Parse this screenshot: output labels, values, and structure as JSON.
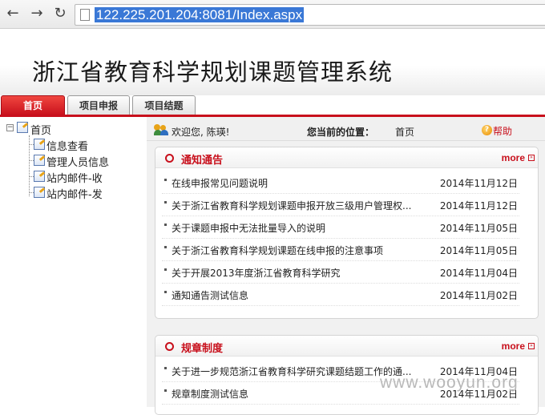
{
  "browser": {
    "url": "122.225.201.204:8081/Index.aspx"
  },
  "header": {
    "system_title": "浙江省教育科学规划课题管理系统"
  },
  "tabs": [
    {
      "label": "首页",
      "active": true
    },
    {
      "label": "项目申报",
      "active": false
    },
    {
      "label": "项目结题",
      "active": false
    }
  ],
  "sidebar": {
    "root": {
      "label": "首页",
      "toggle": "−"
    },
    "items": [
      {
        "label": "信息查看"
      },
      {
        "label": "管理人员信息"
      },
      {
        "label": "站内邮件-收"
      },
      {
        "label": "站内邮件-发"
      }
    ]
  },
  "status": {
    "welcome": "欢迎您, 陈瑛!",
    "location_label": "您当前的位置：",
    "location_value": "首页",
    "help": "帮助"
  },
  "notices": {
    "title": "通知通告",
    "more": "more",
    "rows": [
      {
        "title": "在线申报常见问题说明",
        "date": "2014年11月12日"
      },
      {
        "title": "关于浙江省教育科学规划课题申报开放三级用户管理权...",
        "date": "2014年11月12日"
      },
      {
        "title": "关于课题申报中无法批量导入的说明",
        "date": "2014年11月05日"
      },
      {
        "title": "关于浙江省教育科学规划课题在线申报的注意事项",
        "date": "2014年11月05日"
      },
      {
        "title": "关于开展2013年度浙江省教育科学研究",
        "date": "2014年11月04日"
      },
      {
        "title": "通知通告测试信息",
        "date": "2014年11月02日"
      }
    ]
  },
  "rules": {
    "title": "规章制度",
    "more": "more",
    "rows": [
      {
        "title": "关于进一步规范浙江省教育科学研究课题结题工作的通...",
        "date": "2014年11月04日"
      },
      {
        "title": "规章制度测试信息",
        "date": "2014年11月02日"
      }
    ]
  },
  "watermark": "www.wooyun.org",
  "colors": {
    "accent": "#c8101c",
    "url_highlight": "#3a78d6"
  }
}
